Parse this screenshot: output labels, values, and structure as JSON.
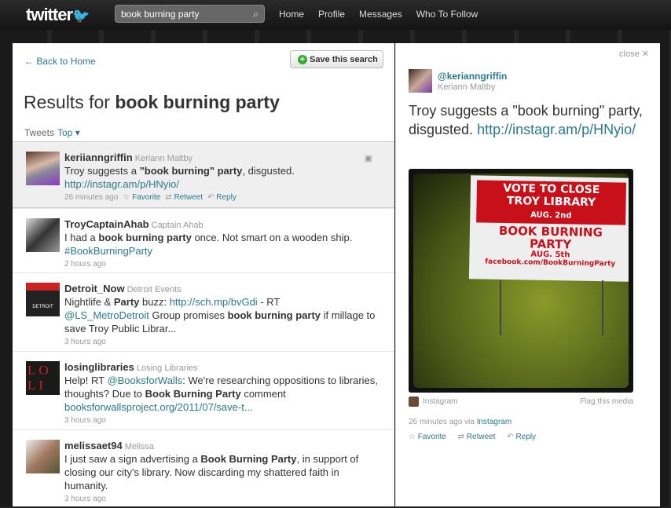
{
  "topbar": {
    "logo": "twitter",
    "search_value": "book burning party",
    "nav": [
      "Home",
      "Profile",
      "Messages",
      "Who To Follow"
    ]
  },
  "left": {
    "back": "← Back to Home",
    "save": "Save this search",
    "title_prefix": "Results for ",
    "title_query": "book burning party",
    "tabs_label": "Tweets",
    "tabs_sort": "Top ▾"
  },
  "actions": {
    "favorite": "Favorite",
    "retweet": "Retweet",
    "reply": "Reply"
  },
  "tweets": [
    {
      "user": "keriianngriffin",
      "name": "Keriann Maltby",
      "t1": "Troy suggests a ",
      "b1": "\"book burning\" party",
      "t2": ", disgusted.",
      "link": "http://instagr.am/p/HNyio/",
      "time": "26 minutes ago"
    },
    {
      "user": "TroyCaptainAhab",
      "name": "Captain Ahab",
      "t1": "I had a ",
      "b1": "book burning party",
      "t2": " once. Not smart on a wooden ship.",
      "link": "#BookBurningParty",
      "time": "2 hours ago"
    },
    {
      "user": "Detroit_Now",
      "name": "Detroit Events",
      "t0": "Nightlife & ",
      "b0": "Party",
      "t0b": " buzz: ",
      "link0": "http://sch.mp/bvGdi",
      "t0c": " - RT ",
      "link": "@LS_MetroDetroit",
      "t1": " Group promises ",
      "b1": "book burning party",
      "t2": " if millage to save Troy Public Librar...",
      "time": "3 hours ago",
      "avatar_text": "DETROIT"
    },
    {
      "user": "losinglibraries",
      "name": "Losing Libraries",
      "t0": "Help! RT ",
      "link0": "@BooksforWalls",
      "t1": ": We're researching oppositions to libraries, thoughts? Due to ",
      "b1": "Book Burning Party",
      "t2": " comment ",
      "link": "booksforwallsproject.org/2011/07/save-t...",
      "time": "3 hours ago",
      "avatar_text": "LO LI"
    },
    {
      "user": "melissaet94",
      "name": "Melissa",
      "t1": "I just saw a sign advertising a ",
      "b1": "Book Burning Party",
      "t2": ", in support of closing our city's library. Now discarding my shattered faith in humanity.",
      "time": "3 hours ago"
    }
  ],
  "right": {
    "close": "close ✕",
    "handle": "@kerianngriffin",
    "name": "Keriann Maltby",
    "text": "Troy suggests a \"book burning\" party, disgusted. ",
    "link": "http://instagr.am/p/HNyio/",
    "sign": [
      "VOTE TO CLOSE",
      "TROY LIBRARY",
      "AUG. 2nd",
      "BOOK BURNING",
      "PARTY",
      "AUG. 5th",
      "facebook.com/BookBurningParty"
    ],
    "source": "Instagram",
    "flag": "Flag this media",
    "time": "26 minutes ago via ",
    "via": "Instagram"
  }
}
